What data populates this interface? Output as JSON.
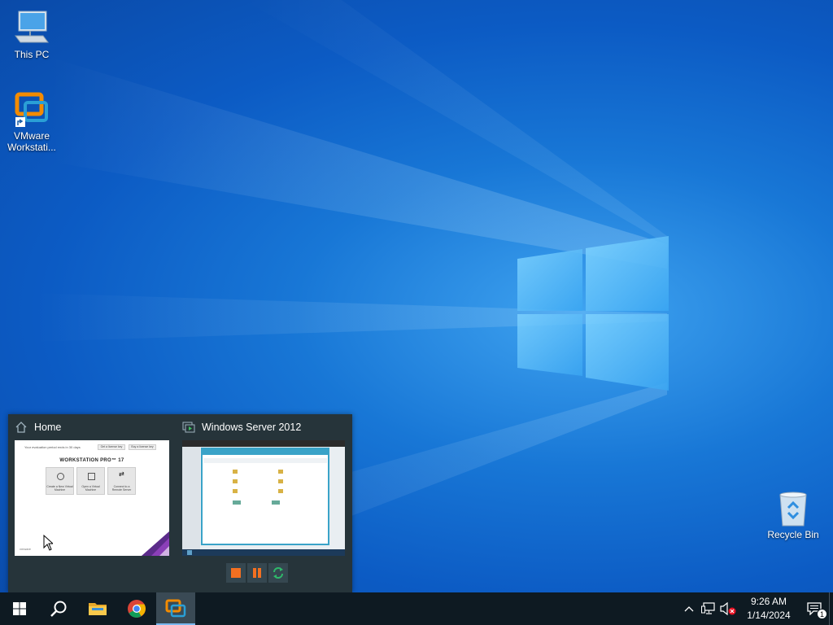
{
  "desktop": {
    "icons": [
      {
        "label": "This PC"
      },
      {
        "label": "VMware Workstati..."
      },
      {
        "label": "Recycle Bin"
      }
    ]
  },
  "flyout": {
    "thumbs": [
      {
        "title": "Home"
      },
      {
        "title": "Windows Server 2012"
      }
    ],
    "home_preview": {
      "banner": "Your evaluation period ends in 30 days",
      "btn_a": "Get a license key",
      "btn_b": "Buy a license key",
      "product": "WORKSTATION PRO™ 17",
      "tiles": [
        "Create a New Virtual Machine",
        "Open a Virtual Machine",
        "Connect to a Remote Server"
      ],
      "brand": "vmware"
    },
    "controls": [
      "stop",
      "pause",
      "restart"
    ]
  },
  "taskbar": {
    "apps": [
      "start",
      "search",
      "file-explorer",
      "chrome",
      "vmware-workstation"
    ],
    "active_app": "vmware-workstation",
    "time": "9:26 AM",
    "date": "1/14/2024",
    "notification_count": "1"
  },
  "colors": {
    "taskbar": "#0e1a22",
    "flyout": "#26343a",
    "accent": "#79b8ef",
    "vmware_orange": "#f38b00"
  }
}
